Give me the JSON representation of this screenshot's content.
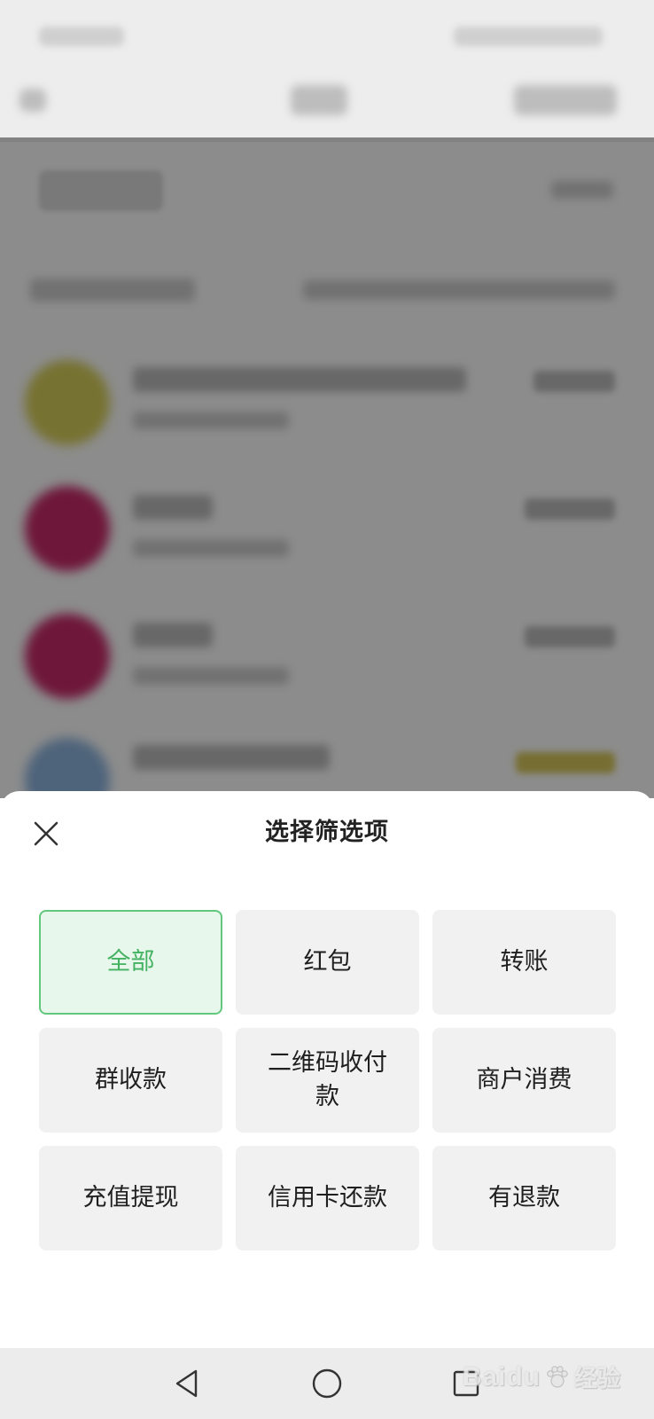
{
  "sheet": {
    "title": "选择筛选项",
    "options": [
      {
        "label": "全部",
        "selected": true
      },
      {
        "label": "红包",
        "selected": false
      },
      {
        "label": "转账",
        "selected": false
      },
      {
        "label": "群收款",
        "selected": false
      },
      {
        "label": "二维码收付款",
        "selected": false
      },
      {
        "label": "商户消费",
        "selected": false
      },
      {
        "label": "充值提现",
        "selected": false
      },
      {
        "label": "信用卡还款",
        "selected": false
      },
      {
        "label": "有退款",
        "selected": false
      }
    ]
  },
  "system_nav": {
    "buttons": [
      "back-triangle-icon",
      "home-circle-icon",
      "recents-square-icon"
    ]
  },
  "watermark": {
    "brand": "Baidu",
    "suffix": "经验"
  },
  "colors": {
    "accent_green": "#43b261",
    "selected_bg": "#e8f7ec",
    "option_bg": "#f1f1f1"
  }
}
